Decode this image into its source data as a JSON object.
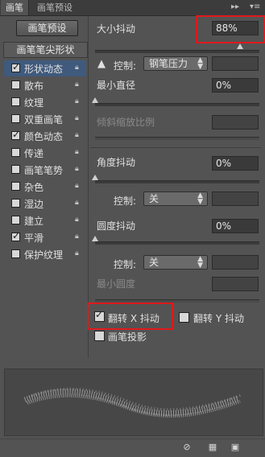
{
  "tabs": {
    "brush": "画笔",
    "presets": "画笔预设"
  },
  "left": {
    "preset_button": "画笔预设",
    "tip_shape": "画笔笔尖形状",
    "items": [
      {
        "label": "形状动态",
        "checked": true,
        "selected": true
      },
      {
        "label": "散布",
        "checked": false,
        "selected": false
      },
      {
        "label": "纹理",
        "checked": false,
        "selected": false
      },
      {
        "label": "双重画笔",
        "checked": false,
        "selected": false
      },
      {
        "label": "颜色动态",
        "checked": true,
        "selected": false
      },
      {
        "label": "传递",
        "checked": false,
        "selected": false
      },
      {
        "label": "画笔笔势",
        "checked": false,
        "selected": false
      },
      {
        "label": "杂色",
        "checked": false,
        "selected": false
      },
      {
        "label": "湿边",
        "checked": false,
        "selected": false
      },
      {
        "label": "建立",
        "checked": false,
        "selected": false
      },
      {
        "label": "平滑",
        "checked": true,
        "selected": false
      },
      {
        "label": "保护纹理",
        "checked": false,
        "selected": false
      }
    ]
  },
  "right": {
    "size_jitter": {
      "label": "大小抖动",
      "value": "88%",
      "slider": 0.88
    },
    "control1": {
      "label": "控制:",
      "value": "钢笔压力"
    },
    "min_diameter": {
      "label": "最小直径",
      "value": "0%",
      "slider": 0.0
    },
    "tilt_scale": {
      "label": "倾斜缩放比例",
      "value": ""
    },
    "angle_jitter": {
      "label": "角度抖动",
      "value": "0%",
      "slider": 0.0
    },
    "control2": {
      "label": "控制:",
      "value": "关"
    },
    "roundness_jitter": {
      "label": "圆度抖动",
      "value": "0%",
      "slider": 0.0
    },
    "control3": {
      "label": "控制:",
      "value": "关"
    },
    "min_roundness": {
      "label": "最小圆度",
      "value": ""
    },
    "flip_x": {
      "label": "翻转 X 抖动",
      "checked": true
    },
    "flip_y": {
      "label": "翻转 Y 抖动",
      "checked": false
    },
    "brush_projection": {
      "label": "画笔投影",
      "checked": false
    }
  },
  "colors": {
    "highlight": "#e0191c",
    "selected_row": "#3f5a7d",
    "panel": "#535353"
  }
}
